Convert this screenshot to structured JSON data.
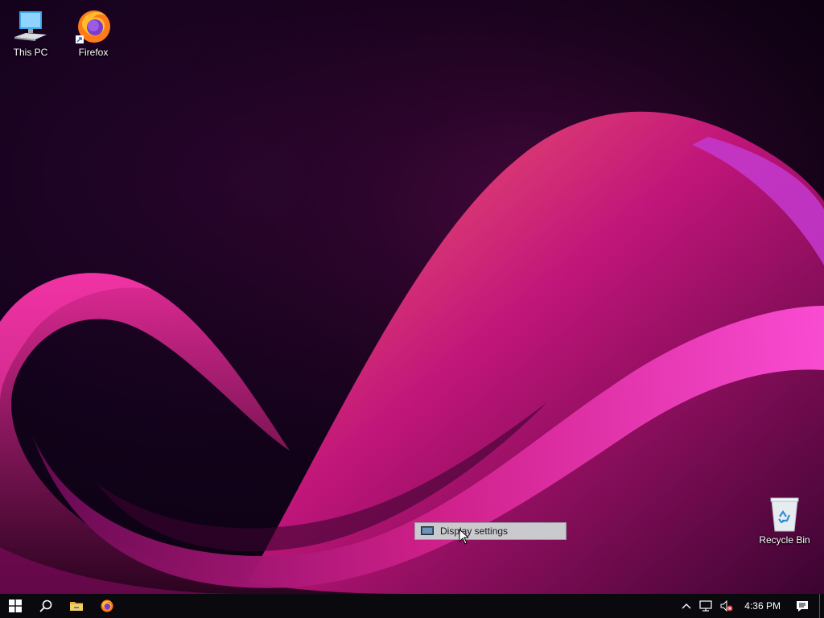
{
  "desktop": {
    "icons": [
      {
        "label": "This PC",
        "icon": "this-pc-icon"
      },
      {
        "label": "Firefox",
        "icon": "firefox-icon"
      },
      {
        "label": "Recycle Bin",
        "icon": "recycle-bin-icon"
      }
    ]
  },
  "context_menu": {
    "items": [
      {
        "label": "Display settings",
        "icon": "display-settings-icon"
      }
    ]
  },
  "taskbar": {
    "pinned": [
      {
        "name": "start",
        "icon": "windows-logo-icon"
      },
      {
        "name": "search",
        "icon": "search-icon"
      },
      {
        "name": "file-explorer",
        "icon": "folder-icon"
      },
      {
        "name": "firefox",
        "icon": "firefox-icon"
      }
    ],
    "tray": {
      "icons": [
        "chevron-up-icon",
        "network-icon",
        "volume-muted-icon"
      ],
      "clock": "4:36 PM",
      "notification_icon": "action-center-icon"
    }
  },
  "colors": {
    "wave_primary": "#c0157a",
    "wave_secondary": "#e83a6a",
    "wave_highlight": "#d23ad6",
    "background": "#0d0210",
    "taskbar": "#0a0a0e",
    "menu_bg": "#c9c9ce"
  }
}
